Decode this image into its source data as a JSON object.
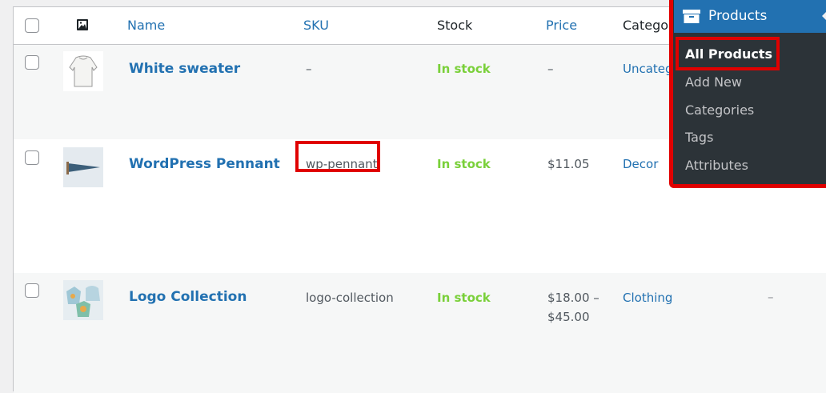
{
  "table": {
    "columns": {
      "name": "Name",
      "sku": "SKU",
      "stock": "Stock",
      "price": "Price",
      "categories": "Catego"
    },
    "rows": [
      {
        "name": "White sweater",
        "sku": "–",
        "stock": "In stock",
        "price": "–",
        "categories": "Uncatego",
        "thumb_icon": "sweater-thumbnail"
      },
      {
        "name": "WordPress Pennant",
        "sku": "wp-pennant",
        "stock": "In stock",
        "price": "$11.05",
        "categories": "Decor",
        "thumb_icon": "pennant-thumbnail"
      },
      {
        "name": "Logo Collection",
        "sku": "logo-collection",
        "stock": "In stock",
        "price_line1": "$18.00 –",
        "price_line2": "$45.00",
        "categories": "Clothing",
        "extra": "–",
        "thumb_icon": "logo-collection-thumbnail"
      }
    ]
  },
  "admin_menu": {
    "section": "Products",
    "section_icon": "archive-box-icon",
    "items": [
      {
        "label": "All Products",
        "current": true
      },
      {
        "label": "Add New"
      },
      {
        "label": "Categories"
      },
      {
        "label": "Tags"
      },
      {
        "label": "Attributes"
      }
    ]
  },
  "colors": {
    "link": "#2271b1",
    "in_stock": "#7ad03a",
    "highlight": "#e00000",
    "menu_bg": "#2c3338",
    "menu_active": "#2271b1"
  }
}
